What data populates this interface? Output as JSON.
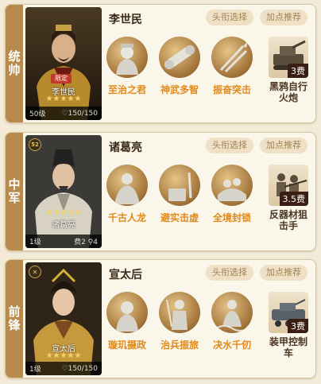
{
  "rows": [
    {
      "role": "统帅",
      "name": "李世民",
      "badge": "限定",
      "stars": "★★★★★",
      "portrait_name": "李世民",
      "level": "50级",
      "troops": "150/150",
      "title_btn": "头衔选择",
      "rec_btn": "加点推荐",
      "skills": [
        "至治之君",
        "神武多智",
        "振奋突击"
      ],
      "equip": {
        "cost": "3费",
        "name_line1": "黑鸦自行",
        "name_line2": "火炮"
      }
    },
    {
      "role": "中军",
      "name": "诸葛亮",
      "stars": "★★★★★",
      "portrait_name": "诸葛亮",
      "round_badge": "52",
      "level": "1级",
      "cost": "费2",
      "deploy": "4",
      "title_btn": "头衔选择",
      "rec_btn": "加点推荐",
      "skills": [
        "千古人龙",
        "避实击虚",
        "全境封锁"
      ],
      "equip": {
        "cost": "3.5费",
        "name_line1": "反器材狙",
        "name_line2": "击手"
      }
    },
    {
      "role": "前锋",
      "name": "宣太后",
      "stars": "★★★★★",
      "portrait_name": "宣太后",
      "level": "1级",
      "troops": "150/150",
      "title_btn": "头衔选择",
      "rec_btn": "加点推荐",
      "skills": [
        "璇玑摄政",
        "治兵振旅",
        "决水千仞"
      ],
      "equip": {
        "cost": "3费",
        "name_line1": "装甲控制",
        "name_line2": "车"
      }
    }
  ],
  "colors": {
    "accent": "#e18a1c",
    "tab": "#b88a4c",
    "chip_bg": "#efe0c6"
  }
}
